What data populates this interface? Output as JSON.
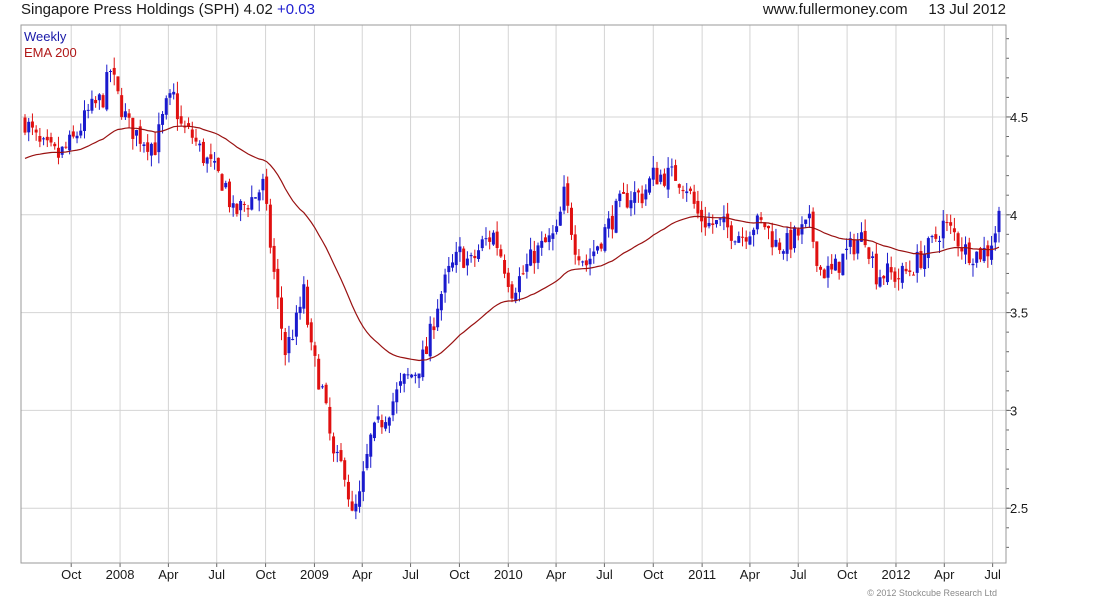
{
  "header": {
    "title": "Singapore Press Holdings (SPH) 4.02",
    "change": "+0.03",
    "site": "www.fullermoney.com",
    "date": "13 Jul 2012"
  },
  "footer": {
    "copyright": "© 2012 Stockcube Research Ltd"
  },
  "colors": {
    "up": "#1a1acd",
    "down": "#e01010",
    "ema": "#991111",
    "grid": "#d4d4d4",
    "axis": "#666666"
  },
  "chart_data": {
    "type": "candlestick",
    "frequency": "weekly",
    "legend": [
      {
        "label": "Weekly",
        "color": "#1a1aa8"
      },
      {
        "label": "EMA 200",
        "color": "#b01818"
      }
    ],
    "legend_position": "top-left",
    "ylim": [
      2.22,
      4.97
    ],
    "yticks": [
      2.5,
      3,
      3.5,
      4,
      4.5
    ],
    "ytick_labels": [
      "2.5",
      "3",
      "3.5",
      "4",
      "4.5"
    ],
    "xticks": [
      {
        "label": "Oct",
        "date": "2007-10-01"
      },
      {
        "label": "2008",
        "date": "2008-01-01"
      },
      {
        "label": "Apr",
        "date": "2008-04-01"
      },
      {
        "label": "Jul",
        "date": "2008-07-01"
      },
      {
        "label": "Oct",
        "date": "2008-10-01"
      },
      {
        "label": "2009",
        "date": "2009-01-01"
      },
      {
        "label": "Apr",
        "date": "2009-04-01"
      },
      {
        "label": "Jul",
        "date": "2009-07-01"
      },
      {
        "label": "Oct",
        "date": "2009-10-01"
      },
      {
        "label": "2010",
        "date": "2010-01-01"
      },
      {
        "label": "Apr",
        "date": "2010-04-01"
      },
      {
        "label": "Jul",
        "date": "2010-07-01"
      },
      {
        "label": "Oct",
        "date": "2010-10-01"
      },
      {
        "label": "2011",
        "date": "2011-01-01"
      },
      {
        "label": "Apr",
        "date": "2011-04-01"
      },
      {
        "label": "Jul",
        "date": "2011-07-01"
      },
      {
        "label": "Oct",
        "date": "2011-10-01"
      },
      {
        "label": "2012",
        "date": "2012-01-01"
      },
      {
        "label": "Apr",
        "date": "2012-04-01"
      },
      {
        "label": "Jul",
        "date": "2012-07-01"
      }
    ],
    "price_path": [
      [
        "2007-07-06",
        4.48
      ],
      [
        "2007-08-03",
        4.35
      ],
      [
        "2007-09-07",
        4.3
      ],
      [
        "2007-10-05",
        4.38
      ],
      [
        "2007-11-02",
        4.52
      ],
      [
        "2007-11-30",
        4.6
      ],
      [
        "2007-12-14",
        4.74
      ],
      [
        "2007-12-28",
        4.6
      ],
      [
        "2008-01-18",
        4.45
      ],
      [
        "2008-02-08",
        4.4
      ],
      [
        "2008-03-07",
        4.35
      ],
      [
        "2008-03-28",
        4.55
      ],
      [
        "2008-04-11",
        4.6
      ],
      [
        "2008-04-25",
        4.45
      ],
      [
        "2008-05-16",
        4.4
      ],
      [
        "2008-06-06",
        4.3
      ],
      [
        "2008-06-27",
        4.22
      ],
      [
        "2008-07-18",
        4.15
      ],
      [
        "2008-08-01",
        4.0
      ],
      [
        "2008-08-22",
        4.05
      ],
      [
        "2008-09-12",
        4.1
      ],
      [
        "2008-09-26",
        4.15
      ],
      [
        "2008-10-10",
        3.85
      ],
      [
        "2008-10-24",
        3.55
      ],
      [
        "2008-11-07",
        3.3
      ],
      [
        "2008-11-28",
        3.45
      ],
      [
        "2008-12-12",
        3.6
      ],
      [
        "2008-12-26",
        3.3
      ],
      [
        "2009-01-16",
        3.1
      ],
      [
        "2009-02-06",
        2.75
      ],
      [
        "2009-02-27",
        2.7
      ],
      [
        "2009-03-13",
        2.45
      ],
      [
        "2009-03-27",
        2.55
      ],
      [
        "2009-04-17",
        2.85
      ],
      [
        "2009-05-08",
        2.95
      ],
      [
        "2009-05-29",
        3.05
      ],
      [
        "2009-06-19",
        3.15
      ],
      [
        "2009-07-10",
        3.2
      ],
      [
        "2009-07-31",
        3.3
      ],
      [
        "2009-08-21",
        3.55
      ],
      [
        "2009-09-11",
        3.7
      ],
      [
        "2009-10-02",
        3.8
      ],
      [
        "2009-10-23",
        3.75
      ],
      [
        "2009-11-13",
        3.85
      ],
      [
        "2009-12-04",
        3.9
      ],
      [
        "2009-12-18",
        3.8
      ],
      [
        "2010-01-08",
        3.62
      ],
      [
        "2010-01-29",
        3.7
      ],
      [
        "2010-02-19",
        3.8
      ],
      [
        "2010-03-12",
        3.85
      ],
      [
        "2010-04-02",
        3.9
      ],
      [
        "2010-04-16",
        4.1
      ],
      [
        "2010-05-07",
        3.85
      ],
      [
        "2010-05-28",
        3.75
      ],
      [
        "2010-06-18",
        3.85
      ],
      [
        "2010-07-09",
        3.95
      ],
      [
        "2010-07-30",
        4.05
      ],
      [
        "2010-08-20",
        4.1
      ],
      [
        "2010-09-10",
        4.1
      ],
      [
        "2010-10-01",
        4.2
      ],
      [
        "2010-10-22",
        4.2
      ],
      [
        "2010-11-12",
        4.2
      ],
      [
        "2010-12-03",
        4.15
      ],
      [
        "2010-12-24",
        4.0
      ],
      [
        "2011-01-14",
        3.95
      ],
      [
        "2011-02-04",
        3.95
      ],
      [
        "2011-02-25",
        3.92
      ],
      [
        "2011-03-18",
        3.9
      ],
      [
        "2011-04-08",
        3.95
      ],
      [
        "2011-04-29",
        3.95
      ],
      [
        "2011-05-20",
        3.85
      ],
      [
        "2011-06-10",
        3.85
      ],
      [
        "2011-07-01",
        3.9
      ],
      [
        "2011-07-22",
        3.95
      ],
      [
        "2011-08-12",
        3.72
      ],
      [
        "2011-09-02",
        3.7
      ],
      [
        "2011-09-23",
        3.78
      ],
      [
        "2011-10-14",
        3.85
      ],
      [
        "2011-11-04",
        3.9
      ],
      [
        "2011-11-25",
        3.7
      ],
      [
        "2011-12-16",
        3.7
      ],
      [
        "2012-01-06",
        3.68
      ],
      [
        "2012-01-27",
        3.72
      ],
      [
        "2012-02-17",
        3.78
      ],
      [
        "2012-03-09",
        3.85
      ],
      [
        "2012-03-30",
        3.95
      ],
      [
        "2012-04-20",
        3.9
      ],
      [
        "2012-05-11",
        3.82
      ],
      [
        "2012-06-01",
        3.8
      ],
      [
        "2012-06-22",
        3.82
      ],
      [
        "2012-07-06",
        3.92
      ],
      [
        "2012-07-13",
        4.02
      ]
    ]
  }
}
